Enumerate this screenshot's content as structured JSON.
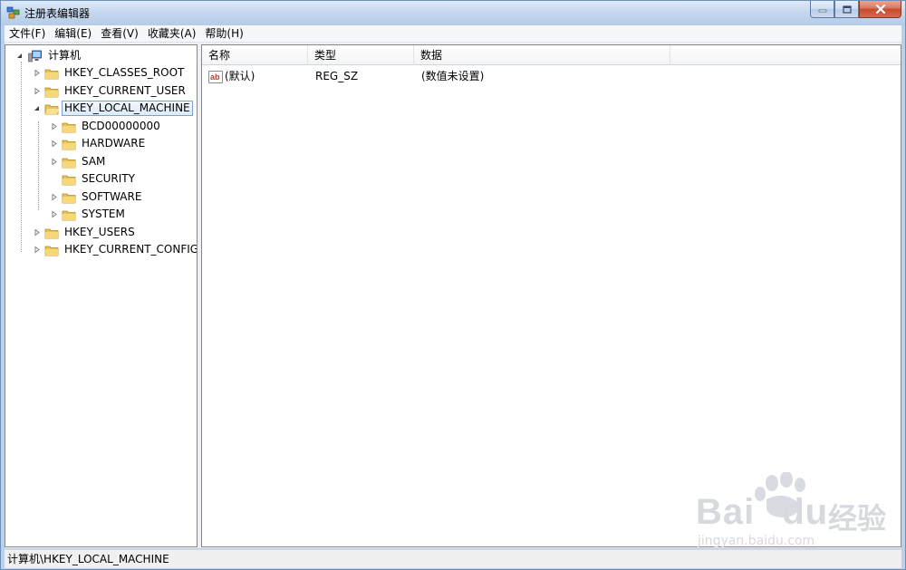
{
  "window": {
    "title": "注册表编辑器"
  },
  "menu": [
    "文件(F)",
    "编辑(E)",
    "查看(V)",
    "收藏夹(A)",
    "帮助(H)"
  ],
  "tree": {
    "root": "计算机",
    "hives": [
      {
        "label": "HKEY_CLASSES_ROOT",
        "expanded": false
      },
      {
        "label": "HKEY_CURRENT_USER",
        "expanded": false
      },
      {
        "label": "HKEY_LOCAL_MACHINE",
        "expanded": true,
        "selected": true,
        "children": [
          "BCD00000000",
          "HARDWARE",
          "SAM",
          "SECURITY",
          "SOFTWARE",
          "SYSTEM"
        ]
      },
      {
        "label": "HKEY_USERS",
        "expanded": false
      },
      {
        "label": "HKEY_CURRENT_CONFIG",
        "expanded": false
      }
    ]
  },
  "list": {
    "columns": [
      "名称",
      "类型",
      "数据"
    ],
    "rows": [
      {
        "name": "(默认)",
        "type": "REG_SZ",
        "data": "(数值未设置)",
        "icon": "string-value-icon"
      }
    ]
  },
  "status": {
    "path": "计算机\\HKEY_LOCAL_MACHINE"
  },
  "watermark": {
    "brand": "Bai",
    "brand2": "du",
    "cn": "经验",
    "url": "jingyan.baidu.com"
  }
}
